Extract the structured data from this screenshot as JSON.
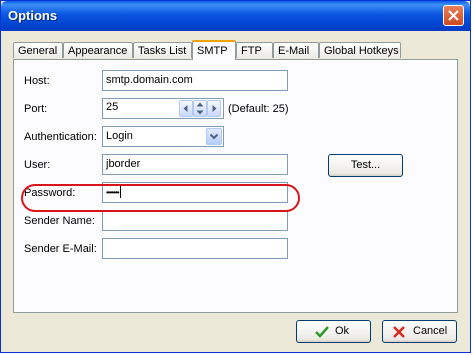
{
  "window": {
    "title": "Options"
  },
  "tabs": [
    {
      "label": "General"
    },
    {
      "label": "Appearance"
    },
    {
      "label": "Tasks List"
    },
    {
      "label": "SMTP"
    },
    {
      "label": "FTP"
    },
    {
      "label": "E-Mail"
    },
    {
      "label": "Global Hotkeys"
    }
  ],
  "active_tab": "SMTP",
  "smtp": {
    "host_label": "Host:",
    "host_value": "smtp.domain.com",
    "port_label": "Port:",
    "port_value": "25",
    "port_default": "(Default: 25)",
    "auth_label": "Authentication:",
    "auth_value": "Login",
    "user_label": "User:",
    "user_value": "jborder",
    "test_button": "Test...",
    "password_label": "Password:",
    "password_value": "•••••••",
    "sender_name_label": "Sender Name:",
    "sender_name_value": "",
    "sender_email_label": "Sender E-Mail:",
    "sender_email_value": ""
  },
  "buttons": {
    "ok": "Ok",
    "cancel": "Cancel"
  },
  "colors": {
    "highlight": "#d9141b",
    "titlebar": "#0a55e0",
    "ok_check": "#2f9a2b",
    "cancel_x": "#d62b1f"
  }
}
